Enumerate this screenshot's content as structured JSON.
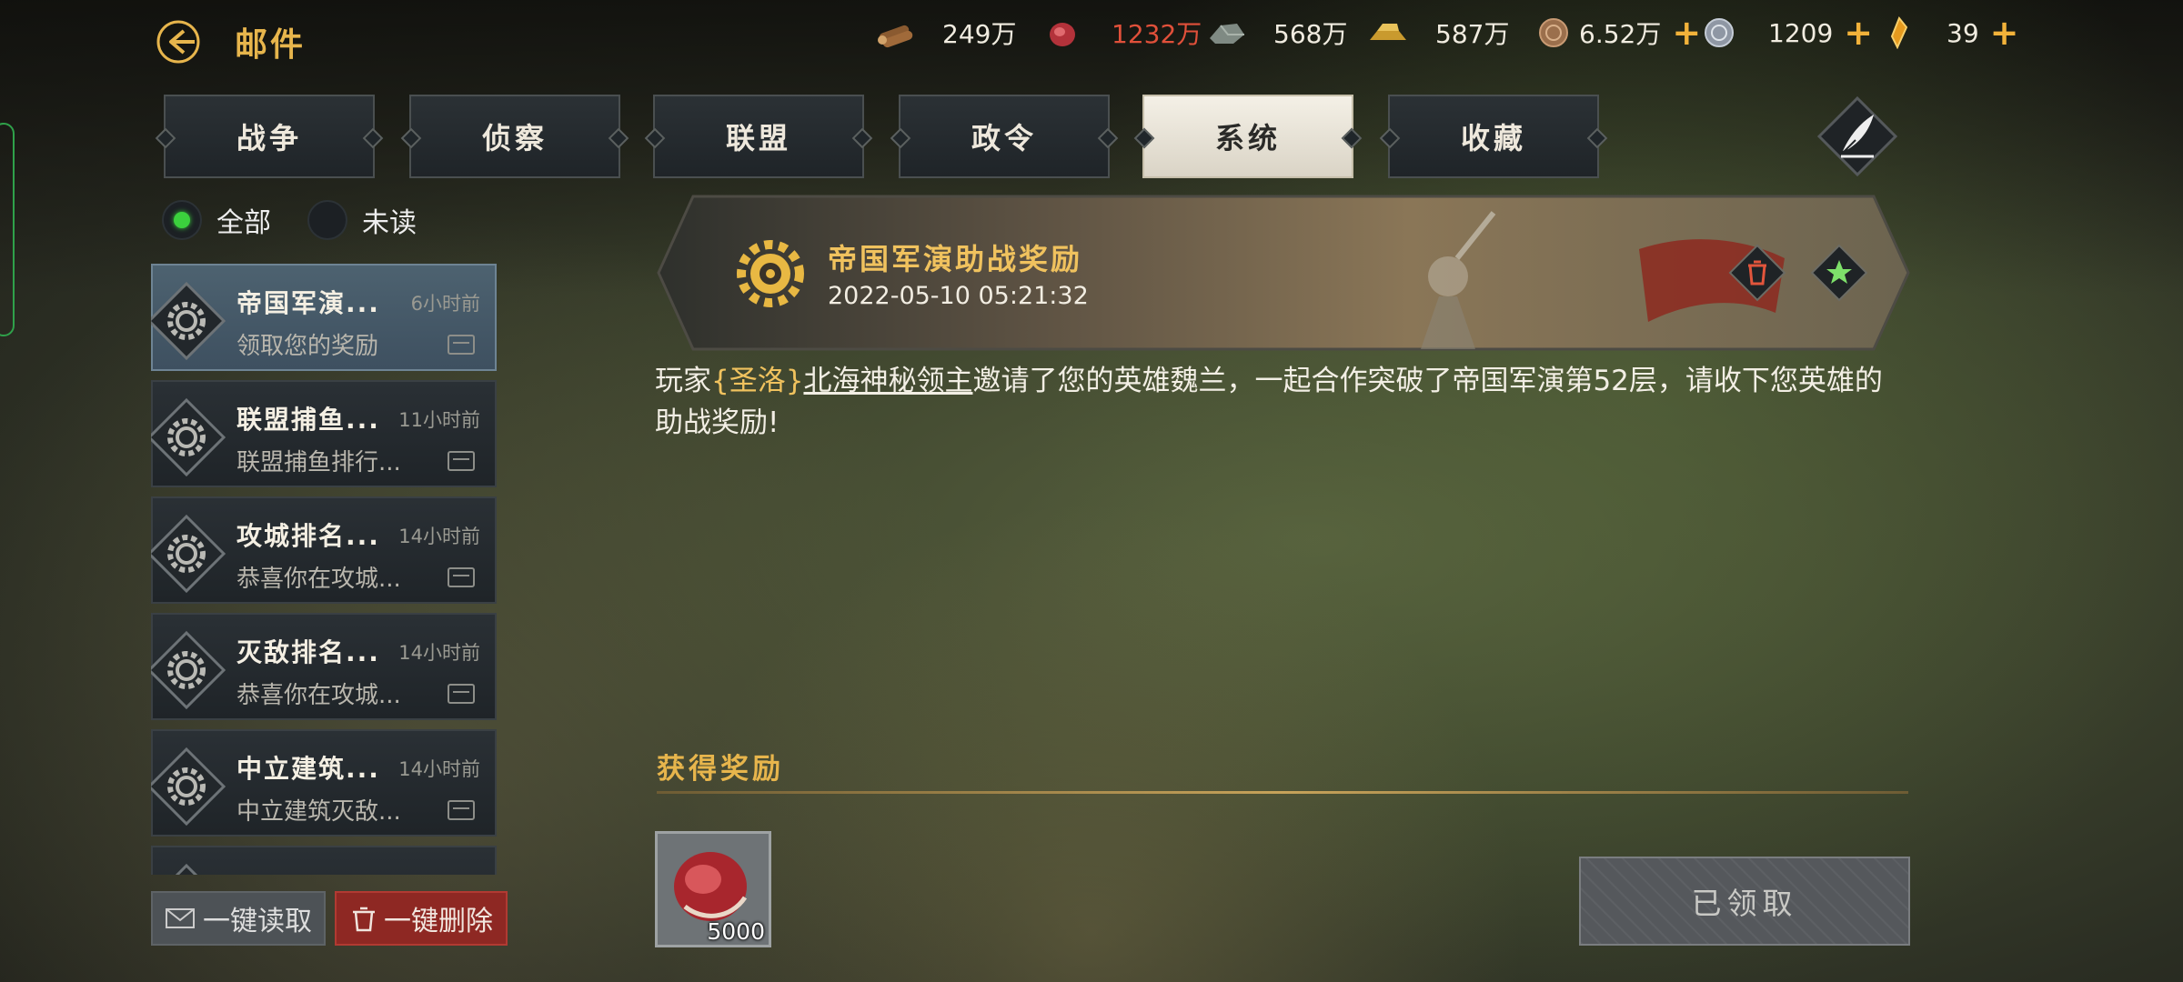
{
  "header": {
    "title": "邮件",
    "resources": [
      {
        "icon": "wood-icon",
        "value": "249万",
        "color": "#f1ece0",
        "plus": false
      },
      {
        "icon": "meat-icon",
        "value": "1232万",
        "color": "#e0503a",
        "plus": false
      },
      {
        "icon": "stone-icon",
        "value": "568万",
        "color": "#f1ece0",
        "plus": false
      },
      {
        "icon": "gold-bar-icon",
        "value": "587万",
        "color": "#f1ece0",
        "plus": false
      },
      {
        "icon": "copper-coin-icon",
        "value": "6.52万",
        "color": "#f1ece0",
        "plus": true
      },
      {
        "icon": "silver-coin-icon",
        "value": "1209",
        "color": "#f1ece0",
        "plus": true
      },
      {
        "icon": "crystal-icon",
        "value": "39",
        "color": "#f1ece0",
        "plus": true
      }
    ],
    "plus_label": "+"
  },
  "tabs": [
    {
      "label": "战争",
      "active": false
    },
    {
      "label": "侦察",
      "active": false
    },
    {
      "label": "联盟",
      "active": false
    },
    {
      "label": "政令",
      "active": false
    },
    {
      "label": "系统",
      "active": true
    },
    {
      "label": "收藏",
      "active": false
    }
  ],
  "filters": {
    "all": "全部",
    "unread": "未读",
    "selected": "all"
  },
  "mails": [
    {
      "title": "帝国军演...",
      "time": "6小时前",
      "subtitle": "领取您的奖励",
      "selected": true
    },
    {
      "title": "联盟捕鱼...",
      "time": "11小时前",
      "subtitle": "联盟捕鱼排行...",
      "selected": false
    },
    {
      "title": "攻城排名...",
      "time": "14小时前",
      "subtitle": "恭喜你在攻城...",
      "selected": false
    },
    {
      "title": "灭敌排名...",
      "time": "14小时前",
      "subtitle": "恭喜你在攻城...",
      "selected": false
    },
    {
      "title": "中立建筑...",
      "time": "14小时前",
      "subtitle": "中立建筑灭敌...",
      "selected": false
    },
    {
      "title": "",
      "time": "",
      "subtitle": "",
      "selected": false
    }
  ],
  "actions": {
    "read_all": "一键读取",
    "delete_all": "一键删除"
  },
  "detail": {
    "title": "帝国军演助战奖励",
    "date": "2022-05-10 05:21:32",
    "body_prefix": "玩家",
    "body_tag": "{圣洛}",
    "body_player": "北海神秘领主",
    "body_rest": "邀请了您的英雄魏兰，一起合作突破了帝国军演第52层，请收下您英雄的助战奖励!",
    "reward_title": "获得奖励",
    "reward_count": "5000",
    "reward_icon": "meat-icon",
    "claimed_label": "已领取"
  }
}
